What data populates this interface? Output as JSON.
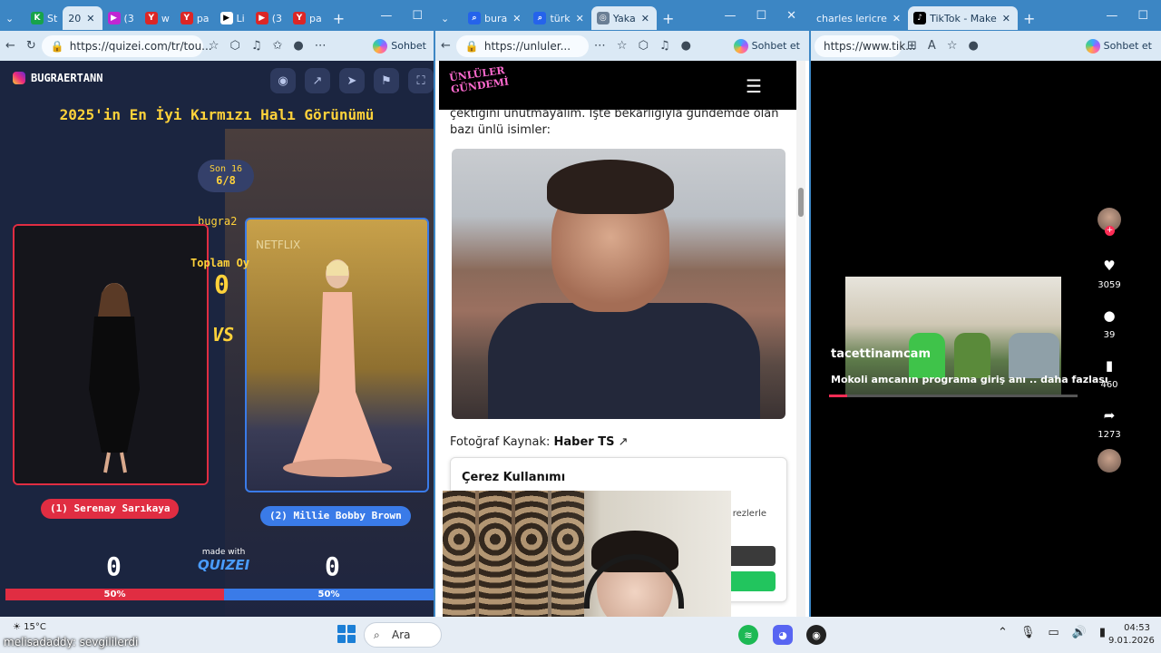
{
  "left_browser": {
    "tabs": [
      {
        "label": "St",
        "color": "#17a34a",
        "glyph": "K"
      },
      {
        "label": "20",
        "color": "#e11d48",
        "glyph": "▶",
        "active": false
      },
      {
        "label": "(3",
        "color": "#c026d3",
        "glyph": "▶"
      },
      {
        "label": "w",
        "color": "#dc2626",
        "glyph": "Y"
      },
      {
        "label": "pa",
        "color": "#dc2626",
        "glyph": "Y"
      },
      {
        "label": "Li",
        "color": "#ffffff",
        "glyph": "▶"
      },
      {
        "label": "(3",
        "color": "#dc2626",
        "glyph": "▶"
      },
      {
        "label": "pa",
        "color": "#dc2626",
        "glyph": "Y"
      }
    ],
    "url": "https://quizei.com/tr/tou...",
    "sohbet": "Sohbet"
  },
  "quiz": {
    "instagram_handle": "BUGRAERTANN",
    "title": "2025'in En İyi Kırmızı Halı Görünümü",
    "round_label": "Son 16",
    "round_progress": "6/8",
    "username": "bugra2",
    "total_label": "Toplam Oy",
    "total_value": "0",
    "vs": "VS",
    "left_name": "(1) Serenay Sarıkaya",
    "right_name": "(2) Millie Bobby Brown",
    "left_score": "0",
    "right_score": "0",
    "made_with": "made with",
    "brand": "QUIZEI",
    "left_pct": "50%",
    "right_pct": "50%",
    "split_fraction": 0.5
  },
  "middle_browser": {
    "tabs": [
      {
        "label": "bura"
      },
      {
        "label": "türk"
      },
      {
        "label": "Yaka"
      }
    ],
    "url": "https://unluler...",
    "sohbet": "Sohbet et",
    "logo_line1": "ÜNLÜLER",
    "logo_line2": "GÜNDEMİ",
    "paragraph": "çektiğini unutmayalım. İşte bekarlığıyla gündemde olan bazı ünlü isimler:",
    "photo_source_label": "Fotoğraf Kaynak:",
    "photo_source": "Haber TS",
    "cookie_title": "Çerez Kullanımı",
    "cookie_text": "rezlerle"
  },
  "right_browser": {
    "tabs": [
      {
        "label": "charles lericre"
      },
      {
        "label": "TikTok - Make"
      }
    ],
    "url": "https://www.tik...",
    "sohbet": "Sohbet et",
    "video_user": "tacettinamcam",
    "video_desc": "Mokoli amcanın programa giriş anı ..",
    "more": "daha fazlası",
    "likes": "3059",
    "comments": "39",
    "saves": "460",
    "shares": "1273"
  },
  "taskbar": {
    "temperature": "15°C",
    "overlay_text": "melisadaddy: sevgililerdi",
    "search": "Ara",
    "time": "04:53",
    "date": "9.01.2026"
  }
}
